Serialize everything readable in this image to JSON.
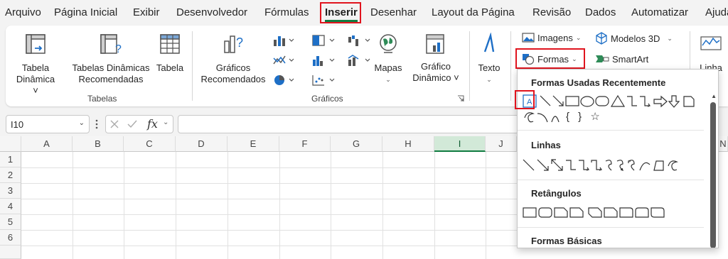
{
  "menu": {
    "tabs": [
      "Arquivo",
      "Página Inicial",
      "Exibir",
      "Desenvolvedor",
      "Fórmulas",
      "Inserir",
      "Desenhar",
      "Layout da Página",
      "Revisão",
      "Dados",
      "Automatizar",
      "Ajuda"
    ],
    "active_tab": "Inserir"
  },
  "ribbon": {
    "tabelas": {
      "tabela_dinamica": "Tabela Dinâmica ˅",
      "tabelas_dinamicas_recomendadas_1": "Tabelas Dinâmicas",
      "tabelas_dinamicas_recomendadas_2": "Recomendadas",
      "tabela": "Tabela",
      "tabela_dinamica_1": "Tabela",
      "tabela_dinamica_2": "Dinâmica ˅",
      "group_label": "Tabelas"
    },
    "graficos": {
      "recomendados_1": "Gráficos",
      "recomendados_2": "Recomendados",
      "mapas": "Mapas",
      "grafico_dinamico_1": "Gráfico",
      "grafico_dinamico_2": "Dinâmico ˅",
      "group_label": "Gráficos"
    },
    "texto": "Texto",
    "imagens": "Imagens",
    "formas": "Formas",
    "modelos3d": "Modelos 3D",
    "smartart": "SmartArt",
    "linha": "Linha"
  },
  "formula_bar": {
    "name_box": "I10",
    "fx": "fx"
  },
  "grid": {
    "columns": [
      "A",
      "B",
      "C",
      "D",
      "E",
      "F",
      "G",
      "H",
      "I",
      "J"
    ],
    "selected_column": "I",
    "rows": [
      "1",
      "2",
      "3",
      "4",
      "5",
      "6"
    ]
  },
  "shapes_menu": {
    "sections": [
      "Formas Usadas Recentemente",
      "Linhas",
      "Retângulos",
      "Formas Básicas"
    ],
    "recent_textbox_glyph": "A",
    "recent_brackets": "{ } ☆",
    "right_edge_label": "N"
  },
  "colors": {
    "accent_green": "#107c41",
    "highlight_red": "#e0141e"
  }
}
